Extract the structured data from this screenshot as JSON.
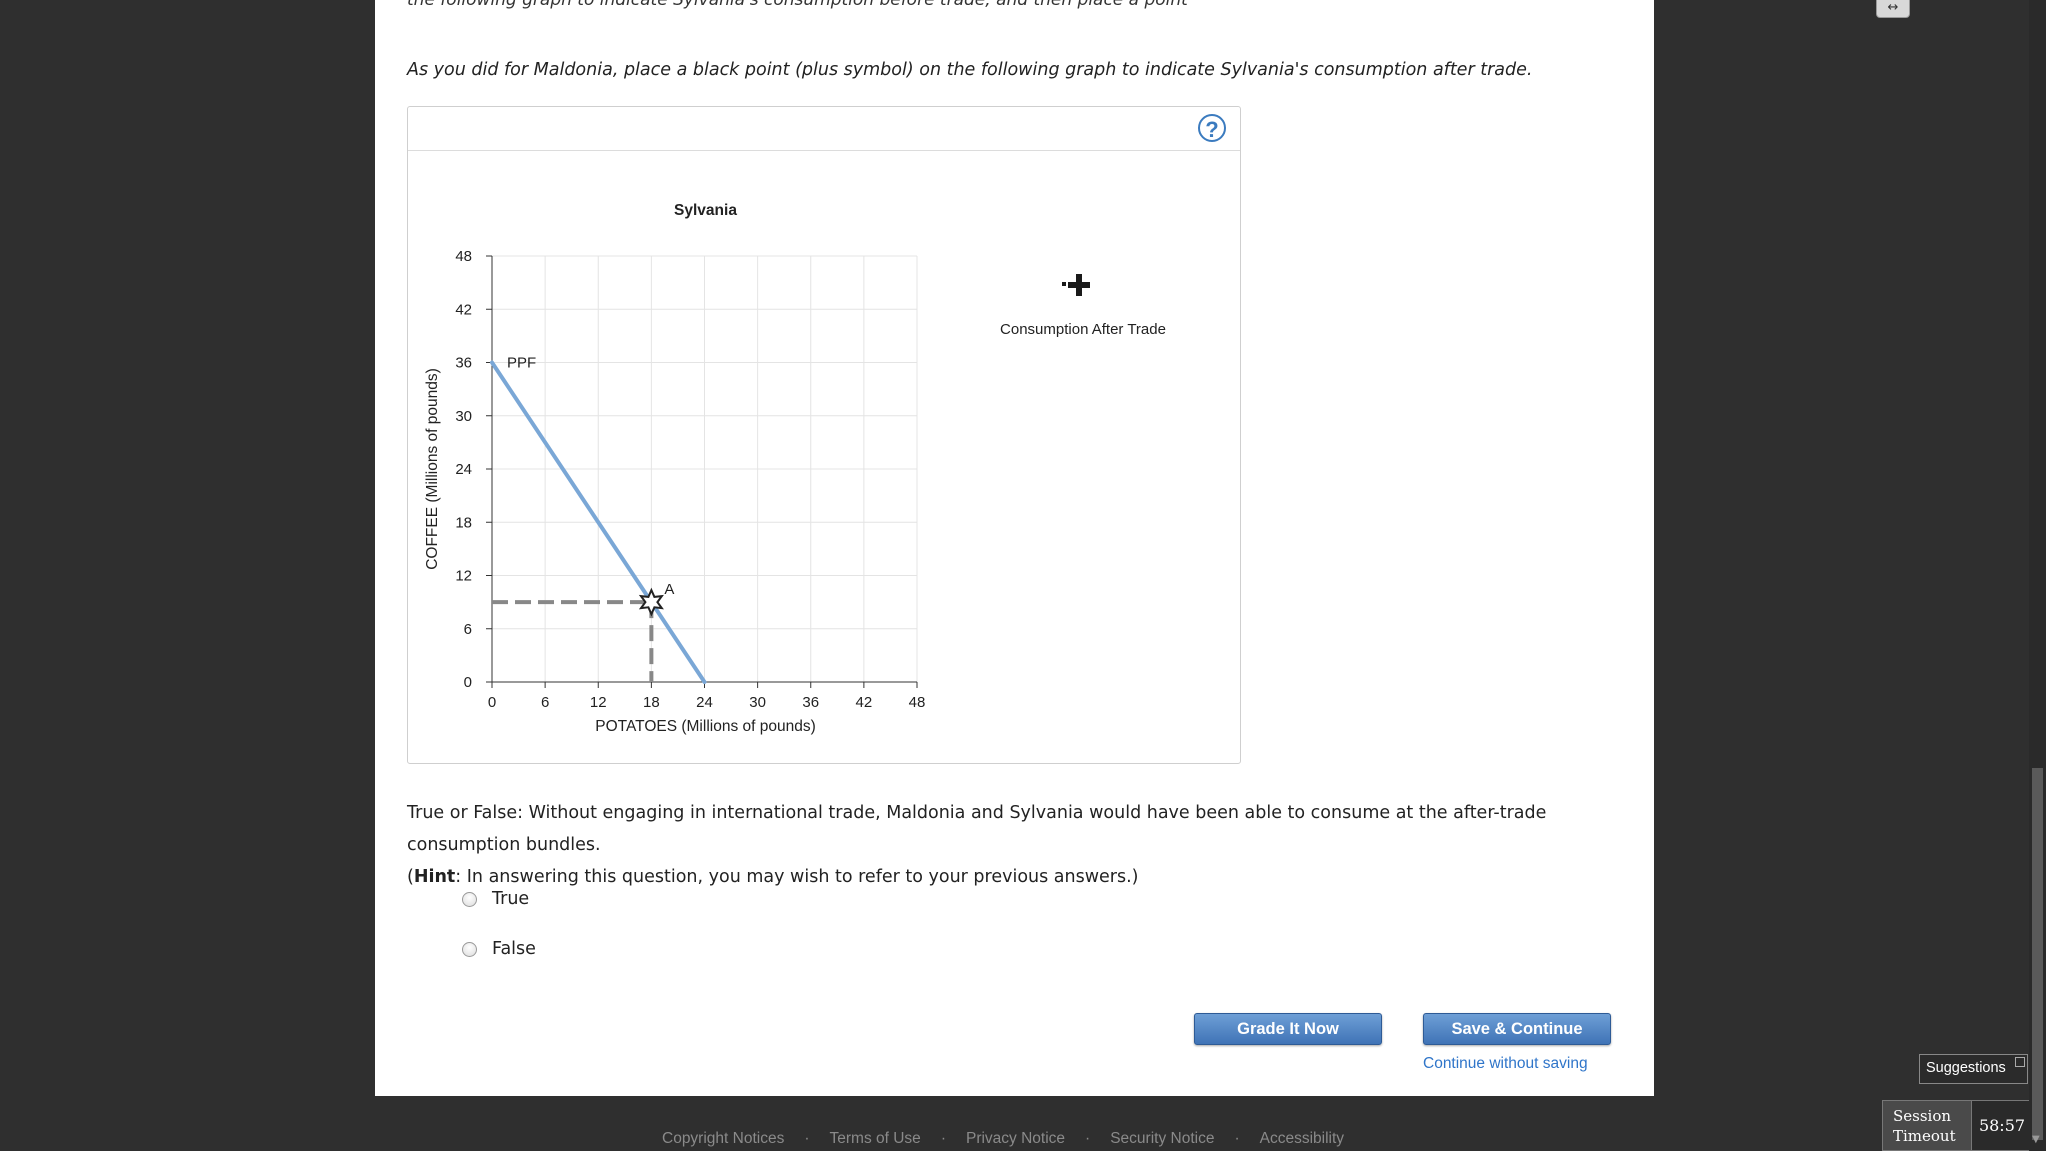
{
  "instruction": "As you did for Maldonia, place a black point (plus symbol) on the following graph to indicate Sylvania's consumption after trade.",
  "cut_off_line": "the following graph to indicate Sylvania's consumption before trade, and then place a point",
  "graph": {
    "help_icon": "?",
    "legend_tool_label": "Consumption After Trade",
    "legend_tool_icon": "plus-symbol"
  },
  "chart_data": {
    "type": "line",
    "title": "Sylvania",
    "xlabel": "POTATOES (Millions of pounds)",
    "ylabel": "COFFEE (Millions of pounds)",
    "xlim": [
      0,
      48
    ],
    "ylim": [
      0,
      48
    ],
    "xticks": [
      0,
      6,
      12,
      18,
      24,
      30,
      36,
      42,
      48
    ],
    "yticks": [
      0,
      6,
      12,
      18,
      24,
      30,
      36,
      42,
      48
    ],
    "grid": true,
    "series": [
      {
        "name": "PPF",
        "x": [
          0,
          24
        ],
        "y": [
          36,
          0
        ],
        "color": "#7aa7d6"
      }
    ],
    "points": [
      {
        "label": "A",
        "x": 18,
        "y": 9,
        "marker": "star"
      }
    ]
  },
  "question": {
    "text": "True or False: Without engaging in international trade, Maldonia and Sylvania would have been able to consume at the after-trade consumption bundles.",
    "hint_open": "(",
    "hint_bold": "Hint",
    "hint_rest": ": In answering this question, you may wish to refer to your previous answers.)",
    "options": [
      "True",
      "False"
    ]
  },
  "buttons": {
    "grade": "Grade It Now",
    "save": "Save & Continue",
    "continue_link": "Continue without saving"
  },
  "footer": {
    "links": [
      "Copyright Notices",
      "Terms of Use",
      "Privacy Notice",
      "Security Notice",
      "Accessibility"
    ],
    "separator": "·"
  },
  "widgets": {
    "suggestions": "Suggestions",
    "session_label_1": "Session",
    "session_label_2": "Timeout",
    "session_time": "58:57"
  }
}
